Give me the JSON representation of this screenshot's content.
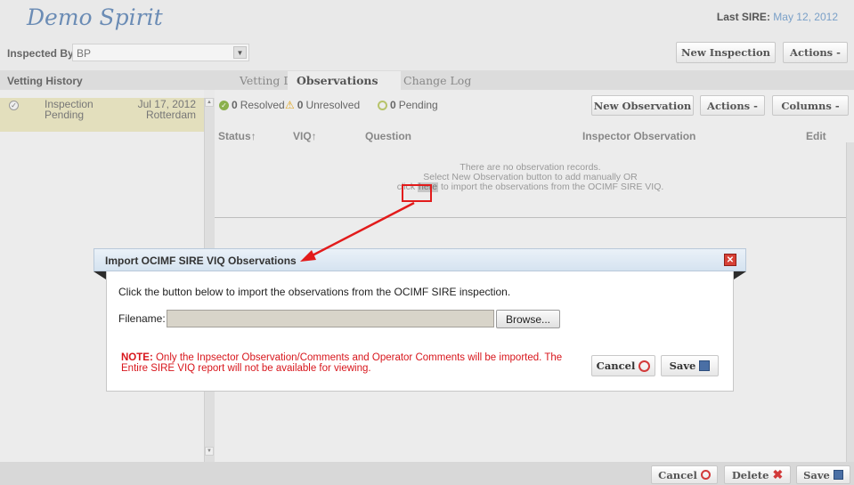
{
  "app": {
    "title": "Demo Spirit"
  },
  "last_sire": {
    "label": "Last SIRE:",
    "date": "May 12, 2012"
  },
  "inspected_by": {
    "label": "Inspected By:",
    "value": "BP"
  },
  "header_buttons": {
    "new_inspection": "New Inspection",
    "actions": "Actions -"
  },
  "vetting_history": {
    "label": "Vetting History",
    "items": [
      {
        "status_line1": "Inspection",
        "status_line2": "Pending",
        "date": "Jul 17, 2012",
        "port": "Rotterdam"
      }
    ]
  },
  "tabs": [
    {
      "label": "Vetting Details"
    },
    {
      "label": "Observations"
    },
    {
      "label": "Change Log"
    }
  ],
  "summary": {
    "resolved_count": "0",
    "resolved_label": "Resolved",
    "unresolved_count": "0",
    "unresolved_label": "Unresolved",
    "pending_count": "0",
    "pending_label": "Pending"
  },
  "toolbar": {
    "new_observation": "New Observation",
    "actions": "Actions -",
    "columns": "Columns -"
  },
  "columns": {
    "status": "Status↑",
    "viq": "VIQ↑",
    "question": "Question",
    "inspector_observation": "Inspector Observation",
    "edit": "Edit"
  },
  "empty_state": {
    "line1": "There are no observation records.",
    "line2": "Select New Observation button to add manually OR",
    "line3_prefix": "click",
    "link": "here",
    "line3_suffix": "to import the observations from the OCIMF SIRE VIQ."
  },
  "dialog": {
    "title": "Import OCIMF SIRE VIQ Observations",
    "instruction": "Click the button below to import the observations from the OCIMF SIRE inspection.",
    "filename_label": "Filename:",
    "filename_value": "",
    "browse": "Browse...",
    "note_label": "NOTE:",
    "note_text": "Only the Inpsector Observation/Comments and Operator Comments will be imported. The Entire SIRE VIQ report will not be available for viewing.",
    "cancel": "Cancel",
    "save": "Save"
  },
  "footer": {
    "cancel": "Cancel",
    "delete": "Delete",
    "save": "Save"
  },
  "colors": {
    "title_blue": "#6b8cb5",
    "highlight_yellow": "#e3dfbd",
    "annotation_red": "#e21b1b",
    "note_red": "#d8161c"
  },
  "icons": {
    "resolved": "check-circle-icon",
    "unresolved": "warning-triangle-icon",
    "pending": "empty-circle-icon",
    "cancel": "prohibited-icon",
    "delete": "red-x-icon",
    "save": "floppy-disk-icon",
    "close": "close-icon"
  }
}
